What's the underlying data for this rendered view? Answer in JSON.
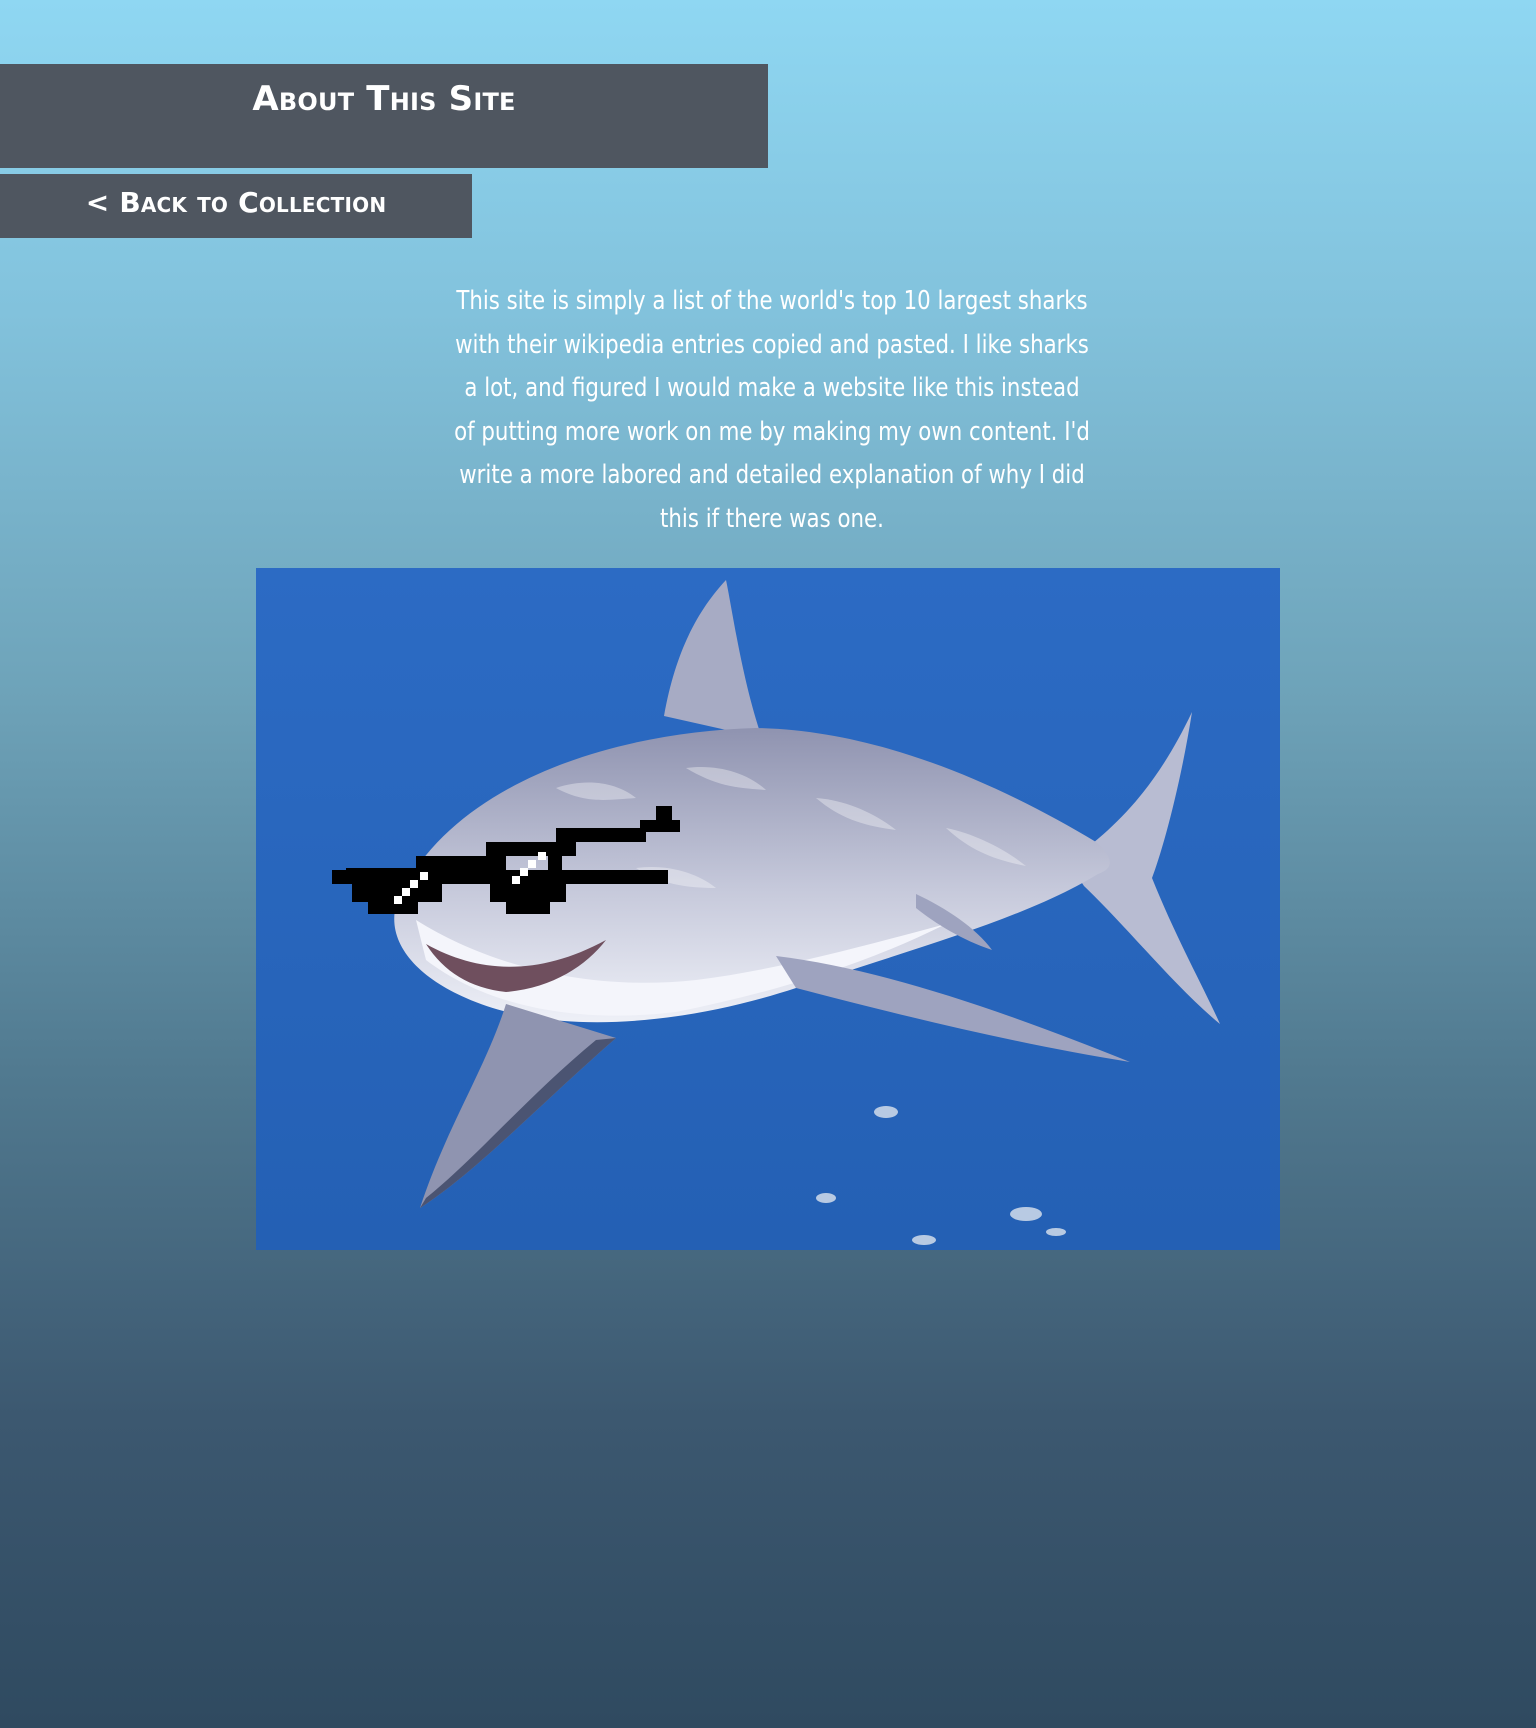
{
  "page": {
    "title": "About This Site",
    "back_link_label": "< Back to Collection",
    "description": "This site is simply a list of the world's top 10 largest sharks with their wikipedia entries copied and pasted. I like sharks a lot, and figured I would make a website like this instead of putting more work on me by making my own content. I'd write a more labored and detailed explanation of why I did this if there was one."
  },
  "image": {
    "subject": "great white shark wearing pixel sunglasses"
  },
  "colors": {
    "header_bg": "#4f5660",
    "text": "#ffffff",
    "gradient_top": "#8fd7f2",
    "gradient_bottom": "#2f4a60",
    "water": "#2a66bd"
  }
}
